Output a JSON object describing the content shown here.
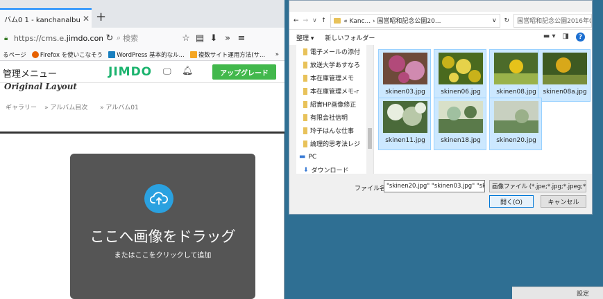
{
  "browser": {
    "tab_title": "バム0 1 - kanchanalbun",
    "tab_close": "✕",
    "new_tab": "+",
    "url_prefix": "https://cms.e.",
    "url_domain": "jimdo.com",
    "url_suffix": "/:",
    "search_placeholder": "検索",
    "bookmarks": [
      {
        "label": "るページ",
        "color": "#888888"
      },
      {
        "label": "Firefox を使いこなそう",
        "color": "#e66000"
      },
      {
        "label": "WordPress 基本的なル...",
        "color": "#1a7fbf"
      },
      {
        "label": "複数サイト運用方法(サ...",
        "color": "#f5a623"
      }
    ],
    "bookmarks_more": "»"
  },
  "jimdo": {
    "admin_label": "管理メニュー",
    "logo": "JIMDO",
    "upgrade_label": "アップグレード",
    "layout_name": "Original Layout",
    "breadcrumbs": [
      "ギャラリー",
      "» アルバム目次",
      "» アルバム01"
    ],
    "drop_title": "ここへ画像をドラッグ",
    "drop_sub": "またはここをクリックして追加"
  },
  "dialog": {
    "path": "« Kanc... › 国営昭和記念公園20...",
    "search_placeholder": "国営昭和記念公園2016年03月...",
    "toolbar": [
      "整理 ▾",
      "新しいフォルダー"
    ],
    "tree_items": [
      "電子メールの添付",
      "放送大学あすなろ",
      "本在庫管理メモ",
      "本在庫管理メモ-r",
      "紹實HP画像修正",
      "有限会社信明",
      "玲子はんな仕事",
      "論理的思考法レジ",
      "PC",
      "ダウンロード"
    ],
    "files": [
      {
        "name": "skinen03.jpg",
        "colors": [
          "#b24a7a",
          "#6e4a3a",
          "#d08ab0"
        ]
      },
      {
        "name": "skinen06.jpg",
        "colors": [
          "#c9b21a",
          "#4a6a1e",
          "#e6d24a"
        ]
      },
      {
        "name": "skinen08.jpg",
        "colors": [
          "#e6c21a",
          "#4c6b2a",
          "#9ab24a"
        ]
      },
      {
        "name": "skinen08a.jpg",
        "colors": [
          "#d8a81a",
          "#3e5a22",
          "#7a8e3a"
        ]
      },
      {
        "name": "skinen11.jpg",
        "colors": [
          "#e8eee0",
          "#4a6a3a",
          "#b8c8a8"
        ]
      },
      {
        "name": "skinen18.jpg",
        "colors": [
          "#a0c0a0",
          "#5a7a4a",
          "#d8e0c8"
        ]
      },
      {
        "name": "skinen20.jpg",
        "colors": [
          "#c8d0c0",
          "#6a8a5a",
          "#9ab08a"
        ]
      }
    ],
    "filename_label": "ファイル名(N):",
    "filename_value": "\"skinen20.jpg\" \"skinen03.jpg\" \"ski",
    "filetype_value": "画像ファイル (*.jpe;*.jpg;*.jpeg;*.g",
    "open_label": "開く(O)",
    "cancel_label": "キャンセル"
  },
  "taskbar": {
    "settings_label": "設定"
  }
}
